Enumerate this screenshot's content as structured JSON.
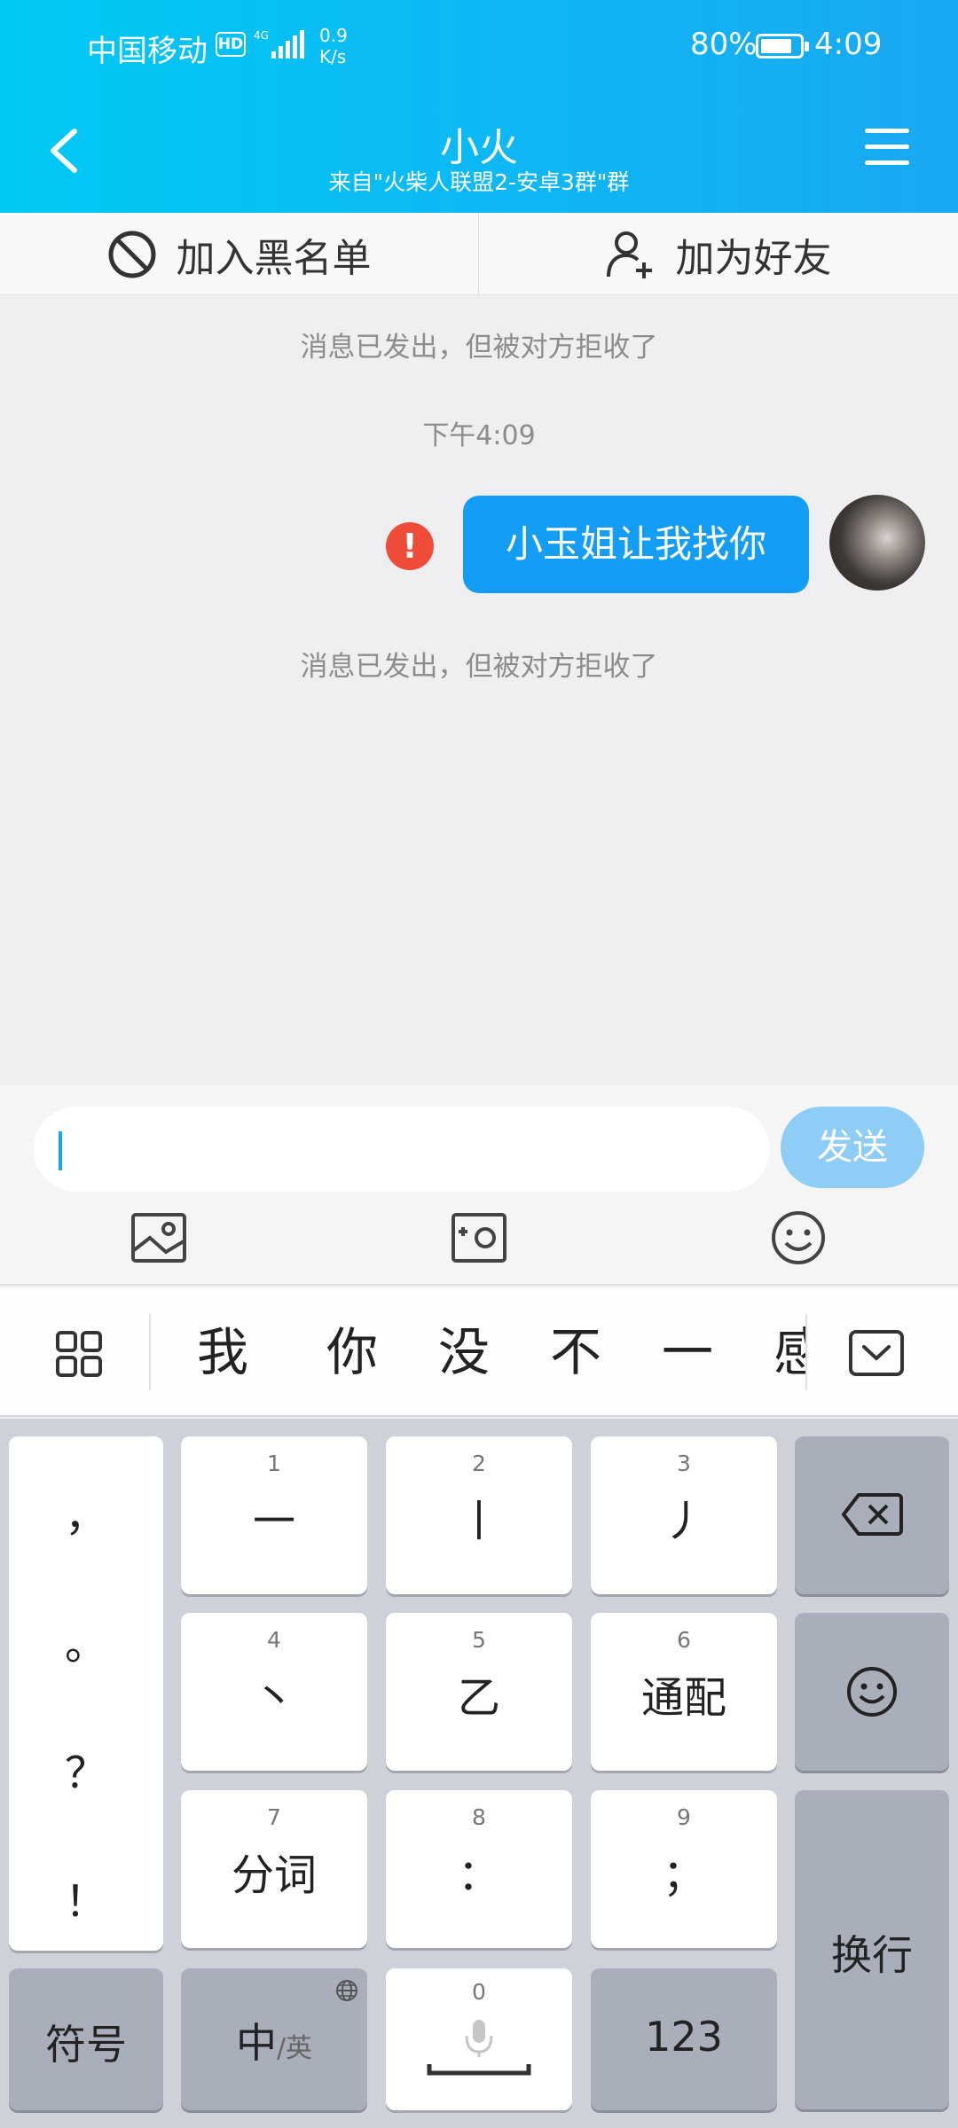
{
  "status_bar": {
    "carrier": "中国移动",
    "hd": "HD",
    "network": "4G",
    "speed_value": "0.9",
    "speed_unit": "K/s",
    "battery": "80%",
    "time": "4:09"
  },
  "header": {
    "title": "小火",
    "subtitle": "来自\"火柴人联盟2-安卓3群\"群"
  },
  "actions": {
    "blacklist_label": "加入黑名单",
    "add_friend_label": "加为好友"
  },
  "chat": {
    "notice_1": "消息已发出，但被对方拒收了",
    "timestamp": "下午4:09",
    "message_text": "小玉姐让我找你",
    "error_mark": "!",
    "notice_2": "消息已发出，但被对方拒收了"
  },
  "input": {
    "value": "",
    "send_label": "发送"
  },
  "candidates": [
    "我",
    "你",
    "没",
    "不",
    "一",
    "感"
  ],
  "keyboard": {
    "punct": [
      "，",
      "。",
      "？",
      "！"
    ],
    "keys": [
      {
        "num": "1",
        "label": "一"
      },
      {
        "num": "2",
        "label": "丨"
      },
      {
        "num": "3",
        "label": "丿"
      },
      {
        "num": "4",
        "label": "丶"
      },
      {
        "num": "5",
        "label": "乙"
      },
      {
        "num": "6",
        "label": "通配"
      },
      {
        "num": "7",
        "label": "分词"
      },
      {
        "num": "8",
        "label": "："
      },
      {
        "num": "9",
        "label": "；"
      }
    ],
    "symbols_label": "符号",
    "lang_main": "中",
    "lang_sub": "/英",
    "space_num": "0",
    "numbers_label": "123",
    "enter_label": "换行"
  },
  "colors": {
    "header_start": "#00c9f5",
    "header_end": "#19a8f2",
    "bubble": "#149df5",
    "send_button": "#8dcdf6",
    "error": "#f04c3a"
  }
}
